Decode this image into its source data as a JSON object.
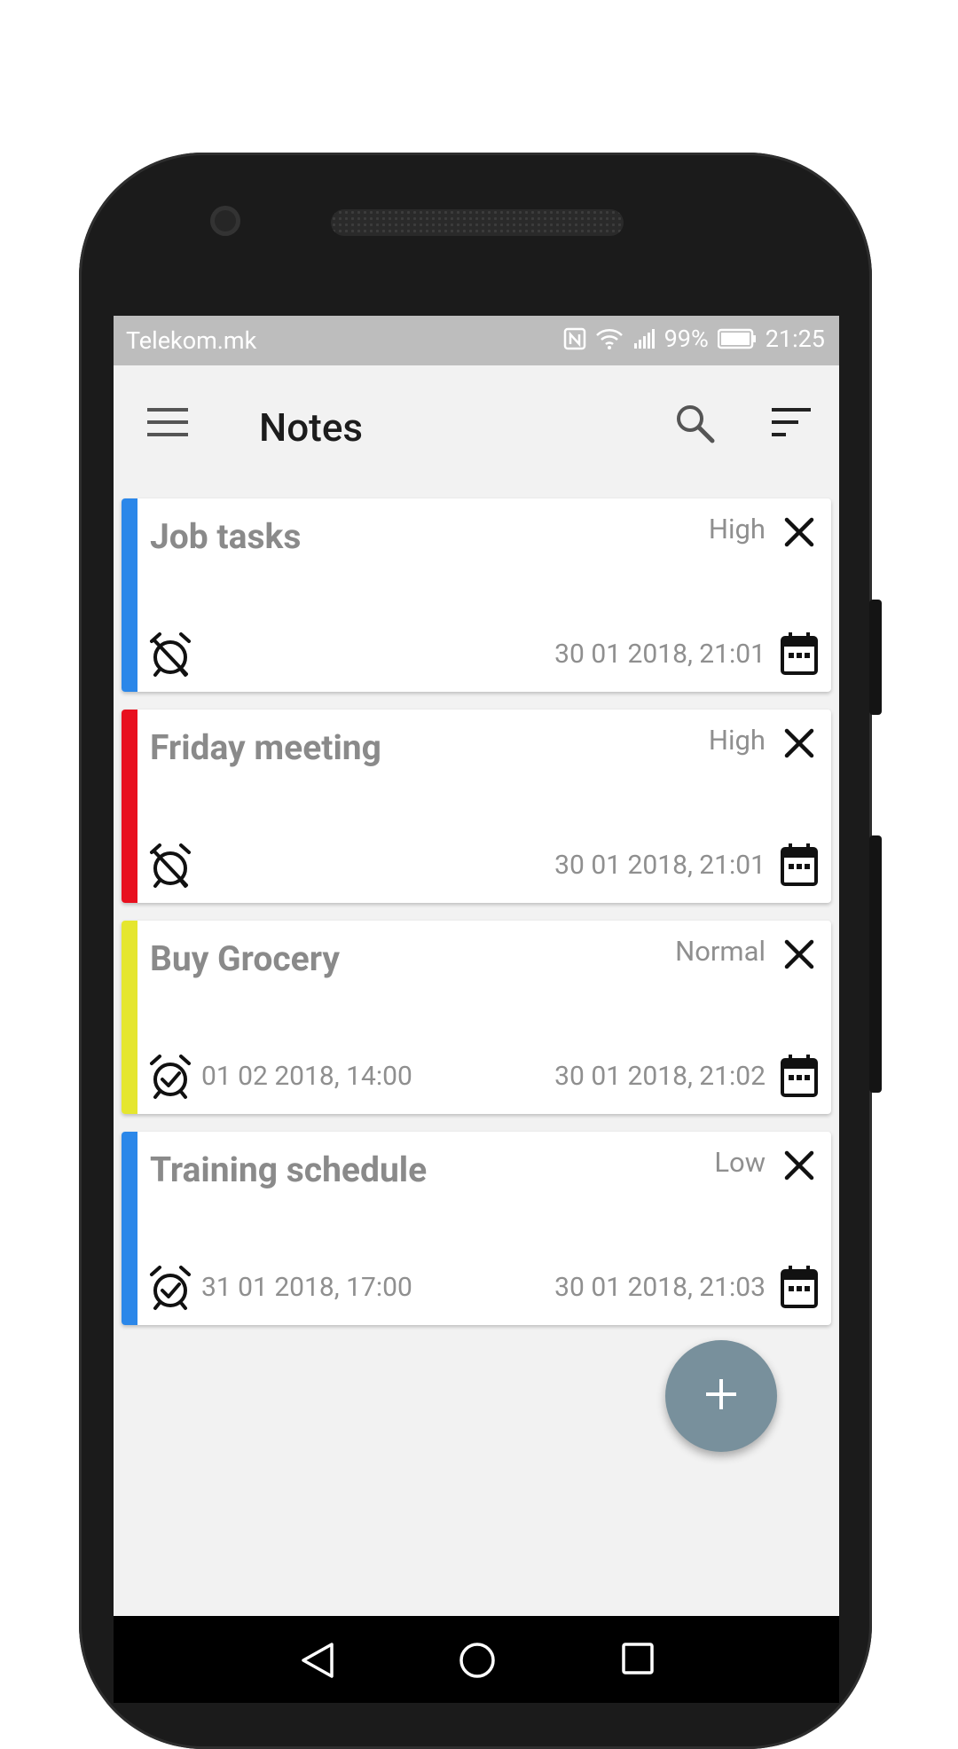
{
  "status_bar": {
    "carrier": "Telekom.mk",
    "battery": "99%",
    "time": "21:25"
  },
  "app_bar": {
    "title": "Notes",
    "icons": [
      "menu-icon",
      "search-icon",
      "sort-icon"
    ]
  },
  "notes": [
    {
      "title": "Job tasks",
      "priority": "High",
      "color": "#2b87e9",
      "reminder_set": false,
      "reminder": "",
      "created": "30 01 2018, 21:01"
    },
    {
      "title": "Friday meeting",
      "priority": "High",
      "color": "#e8101f",
      "reminder_set": false,
      "reminder": "",
      "created": "30 01 2018, 21:01"
    },
    {
      "title": "Buy Grocery",
      "priority": "Normal",
      "color": "#e5e62f",
      "reminder_set": true,
      "reminder": "01 02 2018, 14:00",
      "created": "30 01 2018, 21:02"
    },
    {
      "title": "Training schedule",
      "priority": "Low",
      "color": "#2b87e9",
      "reminder_set": true,
      "reminder": "31 01 2018, 17:00",
      "created": "30 01 2018, 21:03"
    }
  ],
  "fab": {
    "icon": "plus-icon"
  },
  "colors": {
    "fab": "#78909c",
    "status_bar": "#bdbdbd",
    "background": "#f2f2f2"
  }
}
